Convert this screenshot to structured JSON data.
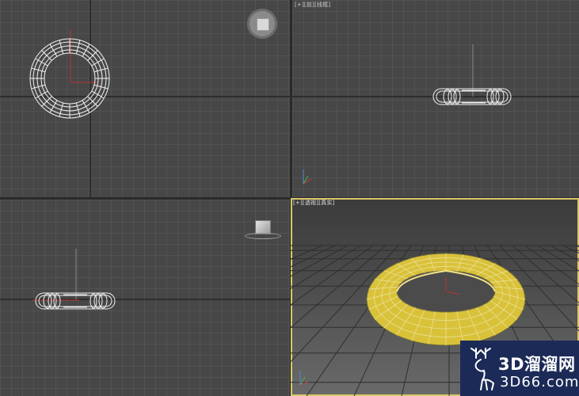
{
  "viewports": {
    "top": {
      "label": ""
    },
    "front": {
      "label": "[+][前][线框]"
    },
    "left": {
      "label": ""
    },
    "perspective": {
      "label": "[+][透视][真实]"
    }
  },
  "watermark": {
    "line1": "3D溜溜网",
    "line2": "3D66.com"
  },
  "colors": {
    "viewport_bg": "#474747",
    "grid": "#525252",
    "wireframe": "#ffffff",
    "torus_fill": "#d9c23a",
    "active_border": "#d9c86a",
    "watermark_bg": "#1c2a57"
  },
  "icons": {
    "viewcube_top": "viewcube-icon",
    "viewcube_left": "viewcube-icon",
    "axis_gizmo": "axis-tripod-icon",
    "logo": "deer-logo-icon"
  }
}
